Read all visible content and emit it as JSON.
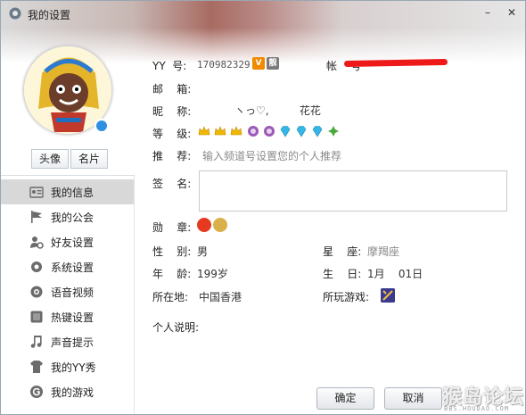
{
  "window": {
    "title": "我的设置",
    "minimize_label": "–",
    "close_label": "✕"
  },
  "sidebar": {
    "tabs": [
      "头像",
      "名片"
    ],
    "items": [
      {
        "label": "我的信息",
        "icon": "id-card-icon",
        "active": true
      },
      {
        "label": "我的公会",
        "icon": "flag-icon"
      },
      {
        "label": "好友设置",
        "icon": "user-gear-icon"
      },
      {
        "label": "系统设置",
        "icon": "gear-icon"
      },
      {
        "label": "语音视频",
        "icon": "camera-icon"
      },
      {
        "label": "热键设置",
        "icon": "keyboard-icon"
      },
      {
        "label": "声音提示",
        "icon": "music-note-icon"
      },
      {
        "label": "我的YY秀",
        "icon": "shirt-icon"
      },
      {
        "label": "我的游戏",
        "icon": "game-g-icon"
      }
    ]
  },
  "profile": {
    "yy_label": "YY  号:",
    "yy_value": "170982329",
    "yy_badge_1": "V",
    "yy_badge_2": "靓",
    "account_label": "帐    号",
    "email_label": "邮    箱:",
    "email_value": "",
    "nickname_label": "昵    称:",
    "nickname_value": "ヽっ♡,         花花",
    "level_label": "等    级:",
    "recommend_label": "推    荐:",
    "recommend_placeholder": "输入频道号设置您的个人推荐",
    "signature_label": "签    名:",
    "signature_value": "",
    "medal_label": "勋    章:",
    "gender_label": "性    别:",
    "gender_value": "男",
    "constellation_label": "星    座:",
    "constellation_value": "摩羯座",
    "age_label": "年    龄:",
    "age_value": "199岁",
    "birthday_label": "生    日:",
    "birthday_value": "1月    01日",
    "location_label": "所在地:",
    "location_value": "中国香港",
    "games_label": "所玩游戏:",
    "about_label": "个人说明:",
    "about_value": ""
  },
  "buttons": {
    "ok": "确定",
    "cancel": "取消"
  },
  "watermark": {
    "main": "猴岛论坛",
    "sub": "BBS.HOUDAO.COM"
  },
  "colors": {
    "accent_blue": "#2f8fe0",
    "redaction_red": "#ee1a1a",
    "crown_gold": "#f0b800",
    "moon_purple": "#9b59b6",
    "diamond_cyan": "#35b6e5",
    "sun_green": "#49a83a"
  }
}
